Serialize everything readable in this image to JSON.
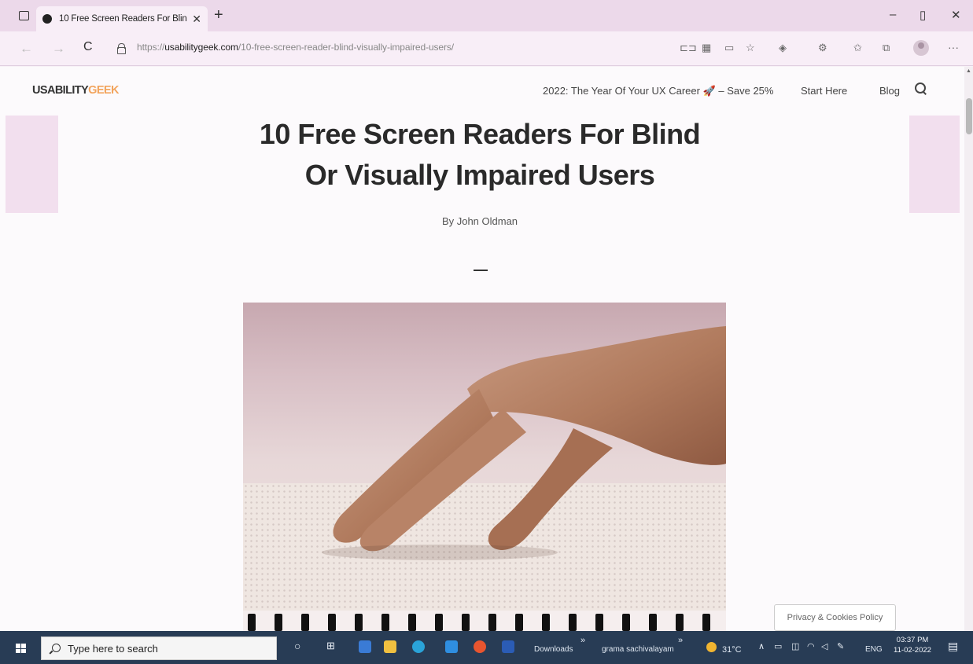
{
  "browser": {
    "tab_title": "10 Free Screen Readers For Blin",
    "tab_close": "✕",
    "new_tab": "+",
    "url_prefix": "https://",
    "url_host": "usabilitygeek.com",
    "url_path": "/10-free-screen-reader-blind-visually-impaired-users/",
    "window_controls": {
      "minimize": "–",
      "restore": "▯",
      "close": "✕"
    },
    "nav_icons": {
      "back": "←",
      "forward": "→",
      "reload": "C"
    },
    "toolbar_icons": [
      "read-aloud-icon",
      "qr-code-icon",
      "immersive-reader-icon",
      "favorite-star-icon",
      "extension-icon",
      "puzzle-icon",
      "favorites-list-icon",
      "collections-icon",
      "profile-avatar-icon",
      "more-menu-icon"
    ],
    "more": "···"
  },
  "site": {
    "logo_main": "USABILITY",
    "logo_accent": "GEEK",
    "nav": {
      "promo": "2022: The Year Of Your UX Career 🚀 – Save 25%",
      "start_here": "Start Here",
      "blog": "Blog"
    }
  },
  "article": {
    "title_line1": "10 Free Screen Readers For Blind",
    "title_line2": "Or Visually Impaired Users",
    "byline": "By John Oldman",
    "hero_image": "hand reading braille on a spiral-bound book"
  },
  "cookie_pill": "Privacy & Cookies Policy",
  "taskbar": {
    "search_placeholder": "Type here to search",
    "downloads_label": "Downloads",
    "folder_label": "grama sachivalayam",
    "weather": "31°C",
    "language": "ENG",
    "time": "03:37 PM",
    "date": "11-02-2022",
    "overflow_marker": "»"
  },
  "colors": {
    "titlebar_bg": "#ecd9ea",
    "page_bg": "#fcfafc",
    "logo_accent": "#f2a45d",
    "taskbar_bg": "#283c55"
  }
}
